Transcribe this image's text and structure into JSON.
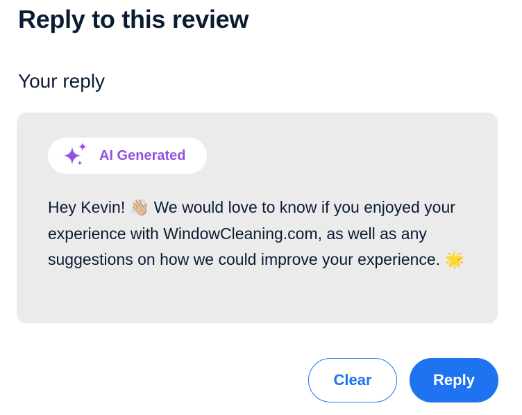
{
  "heading": {
    "title": "Reply to this review",
    "subtitle": "Your reply"
  },
  "reply": {
    "badge": {
      "icon": "sparkles-icon",
      "label": "AI Generated",
      "color": "#9152e3"
    },
    "text_part1": "Hey Kevin! ",
    "emoji_wave": "👋🏼",
    "text_part2": " We would love to know if you enjoyed your experience with WindowCleaning.com, as well as any suggestions on how we could improve your experience. ",
    "emoji_star": "🌟",
    "background": "#ebebeb"
  },
  "actions": {
    "clear_label": "Clear",
    "reply_label": "Reply",
    "accent": "#1f73f1"
  }
}
